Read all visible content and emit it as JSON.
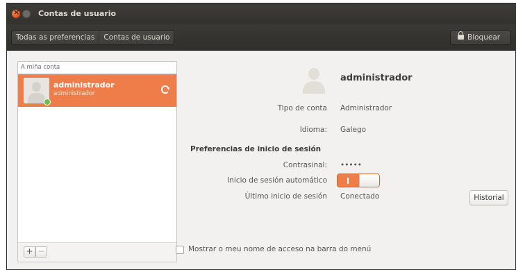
{
  "window": {
    "title": "Contas de usuario"
  },
  "toolbar": {
    "breadcrumbs": [
      "Todas as preferencias",
      "Contas de usuario"
    ],
    "lock_label": "Bloquear"
  },
  "sidebar": {
    "header": "A miña conta",
    "user": {
      "name": "administrador",
      "subtitle": "administrador"
    },
    "add_label": "+",
    "remove_label": "−"
  },
  "detail": {
    "username": "administrador",
    "account_type_label": "Tipo de conta",
    "account_type_value": "Administrador",
    "language_label": "Idioma:",
    "language_value": "Galego",
    "login_section": "Preferencias de inicio de sesión",
    "password_label": "Contrasinal:",
    "password_value": "•••••",
    "autologin_label": "Inicio de sesión automático",
    "autologin_on": true,
    "last_login_label": "Último inicio de sesión",
    "last_login_value": "Conectado",
    "history_button": "Historial"
  },
  "footer": {
    "show_login_name_label": "Mostrar o meu nome de acceso na barra do menú",
    "show_login_name_checked": false
  },
  "colors": {
    "accent": "#ef7d4a",
    "titlebar": "#3a3935",
    "online": "#69c14a"
  },
  "icons": [
    "close-icon",
    "minimize-icon",
    "lock-icon",
    "avatar-icon",
    "refresh-icon",
    "online-status-icon"
  ]
}
